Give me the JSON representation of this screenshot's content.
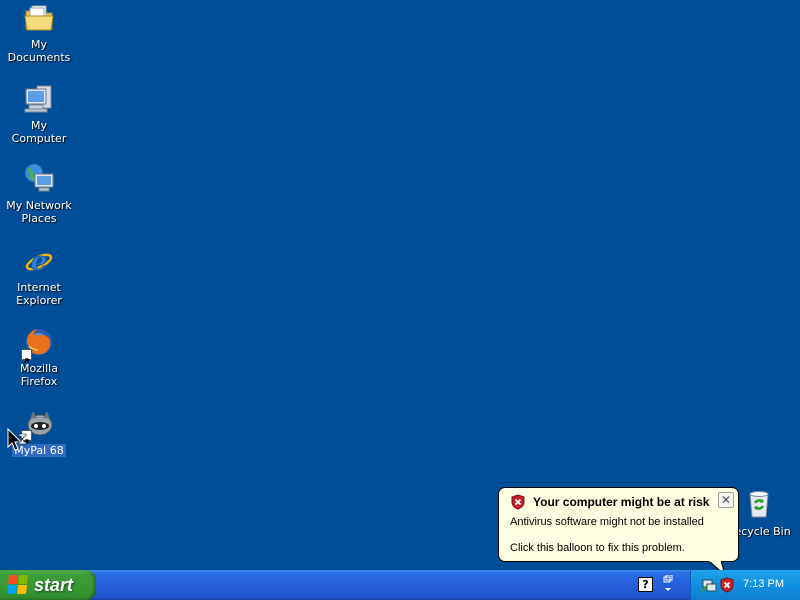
{
  "desktop": {
    "icons": [
      {
        "label": "My Documents",
        "icon": "folder-icon"
      },
      {
        "label": "My Computer",
        "icon": "computer-icon"
      },
      {
        "label": "My Network Places",
        "icon": "network-icon"
      },
      {
        "label": "Internet Explorer",
        "icon": "ie-icon"
      },
      {
        "label": "Mozilla Firefox",
        "icon": "firefox-icon"
      },
      {
        "label": "MyPal 68",
        "icon": "mypal-icon",
        "selected": true
      },
      {
        "label": "Recycle Bin",
        "icon": "recycle-bin-icon"
      }
    ]
  },
  "balloon": {
    "title": "Your computer might be at risk",
    "line1": "Antivirus software might not be installed",
    "line2": "Click this balloon to fix this problem.",
    "icon": "security-shield-icon"
  },
  "taskbar": {
    "start_label": "start",
    "clock": "7:13 PM",
    "tray_icons": [
      "help-icon",
      "network-connection-icon",
      "security-center-icon"
    ]
  },
  "colors": {
    "desktop": "#004e98",
    "taskbar": "#245edb",
    "start_green": "#389834",
    "tray": "#1290e0",
    "balloon": "#ffffe1",
    "selection": "#316ac5"
  }
}
